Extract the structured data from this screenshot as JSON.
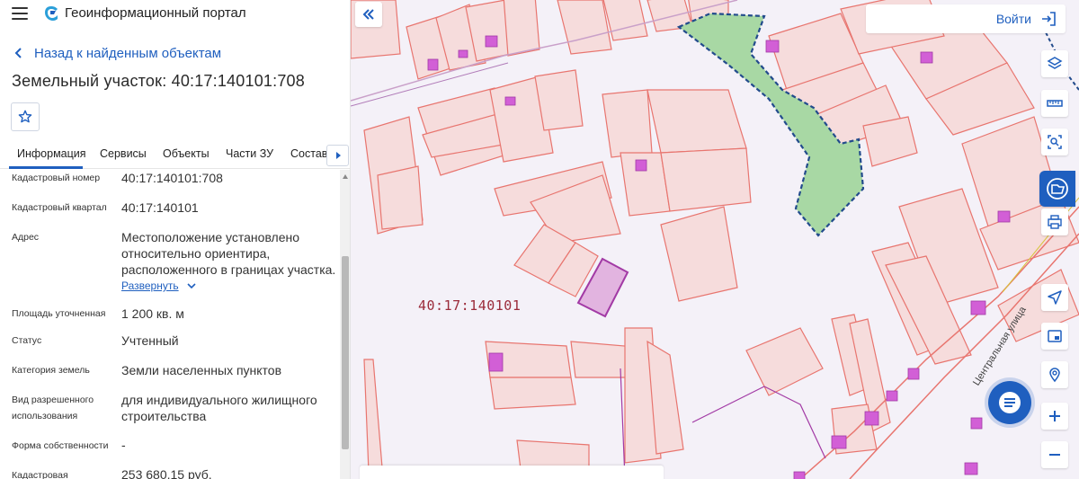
{
  "header": {
    "app_title": "Геоинформационный портал"
  },
  "panel": {
    "back_label": "Назад к найденным объектам",
    "title": "Земельный участок: 40:17:140101:708",
    "tabs": [
      {
        "label": "Информация",
        "active": true
      },
      {
        "label": "Сервисы",
        "active": false
      },
      {
        "label": "Объекты",
        "active": false
      },
      {
        "label": "Части ЗУ",
        "active": false
      },
      {
        "label": "Состав",
        "active": false
      }
    ],
    "properties": {
      "cad_number": {
        "label": "Кадастровый номер",
        "value": "40:17:140101:708"
      },
      "cad_quarter": {
        "label": "Кадастровый квартал",
        "value": "40:17:140101"
      },
      "address": {
        "label": "Адрес",
        "lines": [
          "Местоположение установлено",
          "относительно ориентира,",
          "расположенного в границах участка."
        ],
        "expand_label": "Развернуть"
      },
      "area": {
        "label": "Площадь уточненная",
        "value": "1 200 кв. м"
      },
      "status": {
        "label": "Статус",
        "value": "Учтенный"
      },
      "land_category": {
        "label": "Категория земель",
        "value": "Земли населенных пунктов"
      },
      "permitted_use": {
        "label_lines": [
          "Вид разрешенного",
          "использования"
        ],
        "value_lines": [
          "для индивидуального жилищного",
          "строительства"
        ]
      },
      "ownership": {
        "label": "Форма собственности",
        "value": "-"
      },
      "cad_value": {
        "label": "Кадастровая",
        "value": "253 680,15 руб."
      }
    }
  },
  "map": {
    "quarter_label": "40:17:140101",
    "street_label": "Центральная улица",
    "login_label": "Войти",
    "colors": {
      "parcel_stroke": "#e8756f",
      "parcel_fill": "#f5dada",
      "building_fill": "#d25fd6",
      "selected_stroke": "#a23aa5",
      "green_zone": "#a8d8a4",
      "accent": "#1f5fbf"
    }
  }
}
